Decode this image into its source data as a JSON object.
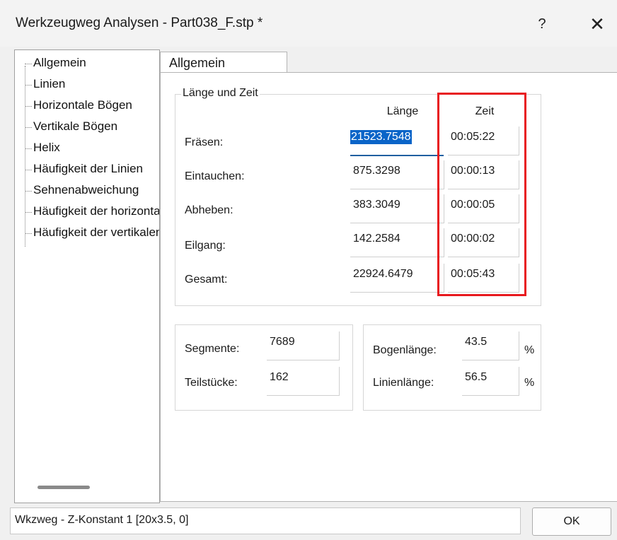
{
  "window": {
    "title": "Werkzeugweg Analysen - Part038_F.stp *",
    "help_label": "?",
    "close_label": "✕"
  },
  "tree": {
    "items": [
      "Allgemein",
      "Linien",
      "Horizontale Bögen",
      "Vertikale Bögen",
      "Helix",
      "Häufigkeit der Linien",
      "Sehnenabweichung",
      "Häufigkeit der horizontalen Bögen",
      "Häufigkeit der vertikalen Bögen"
    ]
  },
  "tab": {
    "label": "Allgemein"
  },
  "laenge_zeit": {
    "group_title": "Länge und Zeit",
    "col_laenge": "Länge",
    "col_zeit": "Zeit",
    "rows": [
      {
        "label": "Fräsen:",
        "laenge": "21523.7548",
        "zeit": "00:05:22"
      },
      {
        "label": "Eintauchen:",
        "laenge": "875.3298",
        "zeit": "00:00:13"
      },
      {
        "label": "Abheben:",
        "laenge": "383.3049",
        "zeit": "00:00:05"
      },
      {
        "label": "Eilgang:",
        "laenge": "142.2584",
        "zeit": "00:00:02"
      },
      {
        "label": "Gesamt:",
        "laenge": "22924.6479",
        "zeit": "00:05:43"
      }
    ]
  },
  "counts": {
    "segmente_label": "Segmente:",
    "segmente_value": "7689",
    "teilstuecke_label": "Teilstücke:",
    "teilstuecke_value": "162"
  },
  "percent": {
    "bogen_label": "Bogenlänge:",
    "bogen_value": "43.5",
    "linien_label": "Linienlänge:",
    "linien_value": "56.5",
    "unit": "%"
  },
  "status": {
    "text": "Wkzweg - Z-Konstant 1 [20x3.5, 0]"
  },
  "buttons": {
    "ok": "OK"
  },
  "colors": {
    "highlight": "#e8191e",
    "selection": "#0a64c8"
  }
}
